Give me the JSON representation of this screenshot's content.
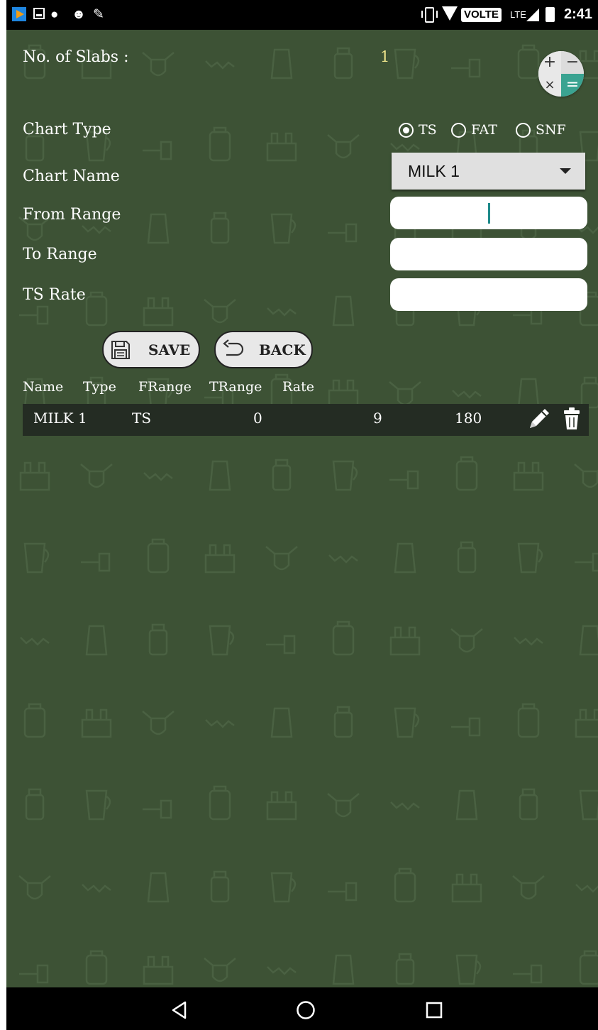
{
  "status_bar": {
    "time": "2:41",
    "network_badge": "VOLTE",
    "network_type": "LTE"
  },
  "form": {
    "slabs_label": "No. of Slabs :",
    "slabs_value": "1",
    "chart_type_label": "Chart Type",
    "chart_type_options": [
      "TS",
      "FAT",
      "SNF"
    ],
    "chart_type_selected": "TS",
    "chart_name_label": "Chart Name",
    "chart_name_value": "MILK 1",
    "from_range_label": "From Range",
    "to_range_label": "To Range",
    "rate_label": "TS Rate"
  },
  "buttons": {
    "save": "SAVE",
    "back": "BACK"
  },
  "table": {
    "headers": [
      "Name",
      "Type",
      "FRange",
      "TRange",
      "Rate"
    ],
    "rows": [
      {
        "name": "MILK 1",
        "type": "TS",
        "frange": "0",
        "trange": "9",
        "rate": "180"
      }
    ]
  },
  "icons": [
    "calculator-icon",
    "save-icon",
    "back-icon",
    "edit-icon",
    "delete-icon"
  ],
  "colors": {
    "background": "#3d5235",
    "row": "#242c23",
    "slab_value": "#f0e68c",
    "cursor": "#1e8a8a"
  }
}
